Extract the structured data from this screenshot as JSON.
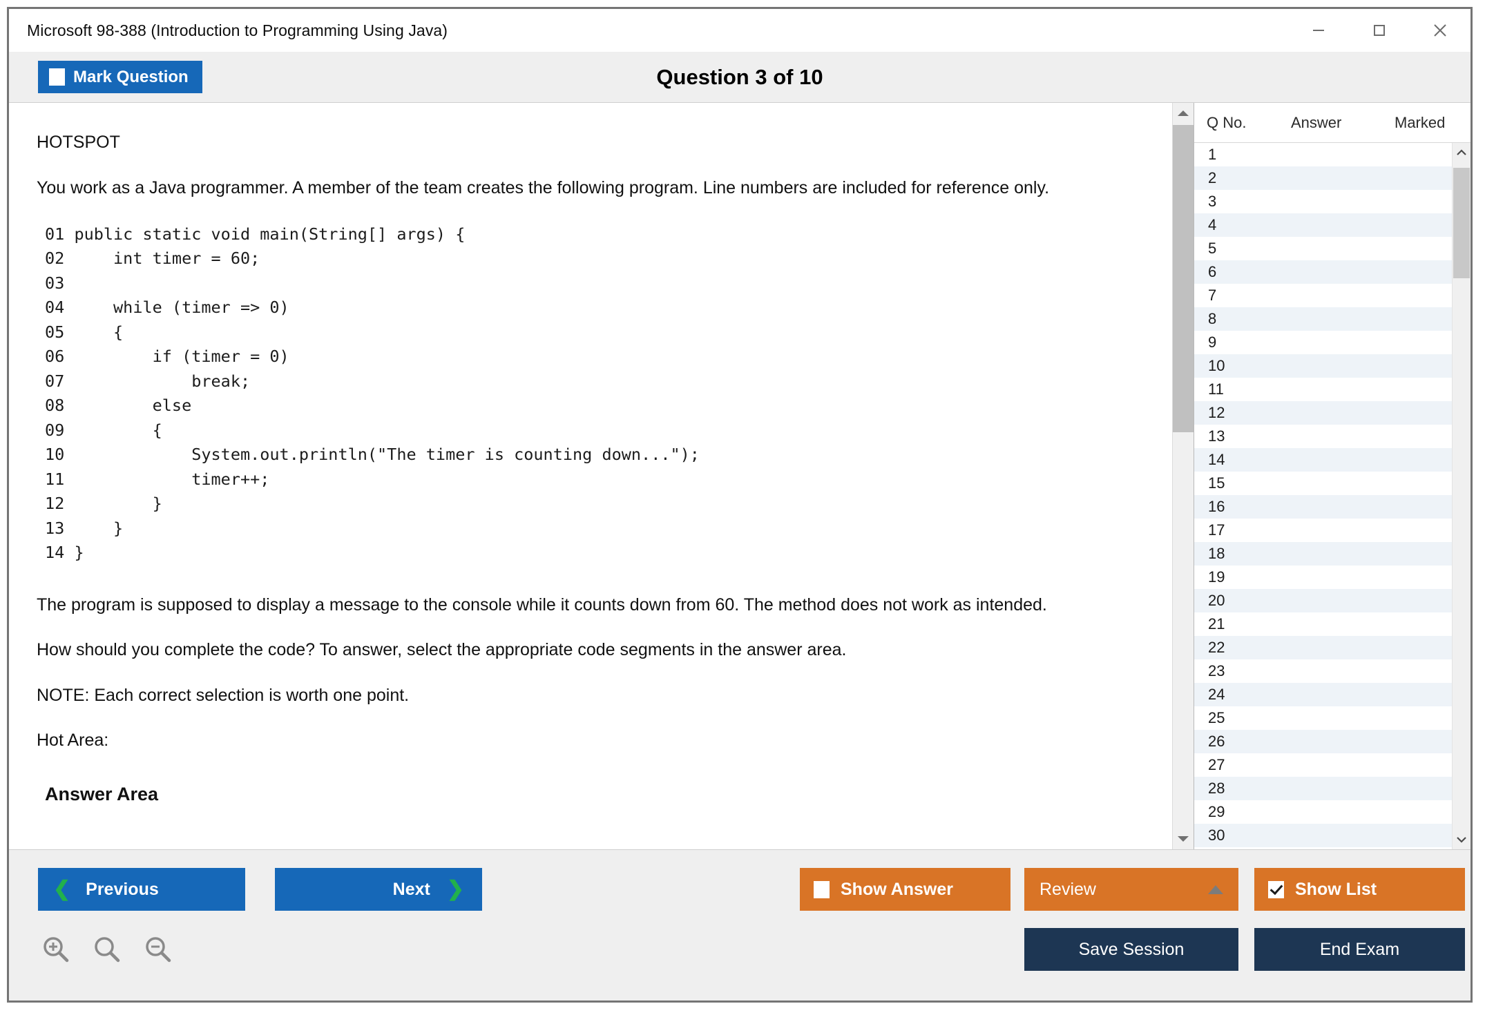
{
  "window": {
    "title": "Microsoft 98-388 (Introduction to Programming Using Java)",
    "minimize_label": "Minimize",
    "maximize_label": "Maximize",
    "close_label": "Close"
  },
  "header": {
    "mark_question_label": "Mark Question",
    "mark_question_checked": false,
    "question_title": "Question 3 of 10"
  },
  "question": {
    "type_label": "HOTSPOT",
    "intro": "You work as a Java programmer. A member of the team creates the following program. Line numbers are included for reference only.",
    "code": "01 public static void main(String[] args) {\n02     int timer = 60;\n03\n04     while (timer => 0)\n05     {\n06         if (timer = 0)\n07             break;\n08         else\n09         {\n10             System.out.println(\"The timer is counting down...\");\n11             timer++;\n12         }\n13     }\n14 }",
    "paragraph_2": "The program is supposed to display a message to the console while it counts down from 60. The method does not work as intended.",
    "paragraph_3": "How should you complete the code? To answer, select the appropriate code segments in the answer area.",
    "note": "NOTE: Each correct selection is worth one point.",
    "hot_area_label": "Hot Area:",
    "answer_area_label": "Answer Area"
  },
  "sidebar": {
    "columns": [
      "Q No.",
      "Answer",
      "Marked"
    ],
    "rows": [
      {
        "no": "1",
        "answer": "",
        "marked": ""
      },
      {
        "no": "2",
        "answer": "",
        "marked": ""
      },
      {
        "no": "3",
        "answer": "",
        "marked": ""
      },
      {
        "no": "4",
        "answer": "",
        "marked": ""
      },
      {
        "no": "5",
        "answer": "",
        "marked": ""
      },
      {
        "no": "6",
        "answer": "",
        "marked": ""
      },
      {
        "no": "7",
        "answer": "",
        "marked": ""
      },
      {
        "no": "8",
        "answer": "",
        "marked": ""
      },
      {
        "no": "9",
        "answer": "",
        "marked": ""
      },
      {
        "no": "10",
        "answer": "",
        "marked": ""
      },
      {
        "no": "11",
        "answer": "",
        "marked": ""
      },
      {
        "no": "12",
        "answer": "",
        "marked": ""
      },
      {
        "no": "13",
        "answer": "",
        "marked": ""
      },
      {
        "no": "14",
        "answer": "",
        "marked": ""
      },
      {
        "no": "15",
        "answer": "",
        "marked": ""
      },
      {
        "no": "16",
        "answer": "",
        "marked": ""
      },
      {
        "no": "17",
        "answer": "",
        "marked": ""
      },
      {
        "no": "18",
        "answer": "",
        "marked": ""
      },
      {
        "no": "19",
        "answer": "",
        "marked": ""
      },
      {
        "no": "20",
        "answer": "",
        "marked": ""
      },
      {
        "no": "21",
        "answer": "",
        "marked": ""
      },
      {
        "no": "22",
        "answer": "",
        "marked": ""
      },
      {
        "no": "23",
        "answer": "",
        "marked": ""
      },
      {
        "no": "24",
        "answer": "",
        "marked": ""
      },
      {
        "no": "25",
        "answer": "",
        "marked": ""
      },
      {
        "no": "26",
        "answer": "",
        "marked": ""
      },
      {
        "no": "27",
        "answer": "",
        "marked": ""
      },
      {
        "no": "28",
        "answer": "",
        "marked": ""
      },
      {
        "no": "29",
        "answer": "",
        "marked": ""
      },
      {
        "no": "30",
        "answer": "",
        "marked": ""
      }
    ]
  },
  "footer": {
    "previous_label": "Previous",
    "next_label": "Next",
    "show_answer_label": "Show Answer",
    "show_answer_checked": false,
    "review_label": "Review",
    "show_list_label": "Show List",
    "show_list_checked": true,
    "save_session_label": "Save Session",
    "end_exam_label": "End Exam",
    "zoom_in_label": "Zoom In",
    "zoom_reset_label": "Zoom",
    "zoom_out_label": "Zoom Out"
  },
  "colors": {
    "blue": "#1668b8",
    "orange": "#d97426",
    "navy": "#1d3653",
    "green_chevron": "#22b14c",
    "header_bg": "#efefef",
    "row_alt": "#eef3f8"
  }
}
